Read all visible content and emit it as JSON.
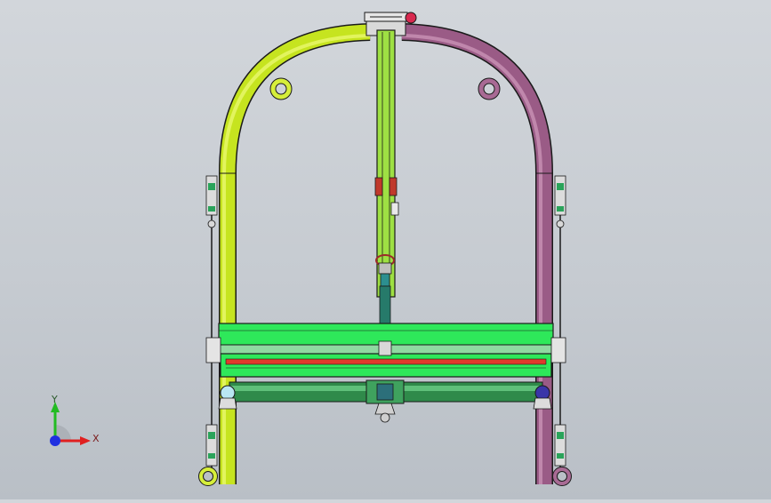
{
  "viewport": {
    "background_top": "#d2d6db",
    "background_bottom": "#b9bfc6"
  },
  "model": {
    "colors": {
      "left_frame": "#ccea27",
      "right_frame": "#9a5b86",
      "center_arm": "#9ee043",
      "crossbar": "#2ee85a",
      "crossbar_dark": "#10a93a",
      "red_rod": "#e03a2c",
      "lower_roller": "#2f8a4a",
      "outline": "#1a1a1a"
    }
  },
  "triad": {
    "x_label": "X",
    "y_label": "Y",
    "x_color": "#e02020",
    "y_color": "#22bb22",
    "z_color": "#2030e0"
  }
}
